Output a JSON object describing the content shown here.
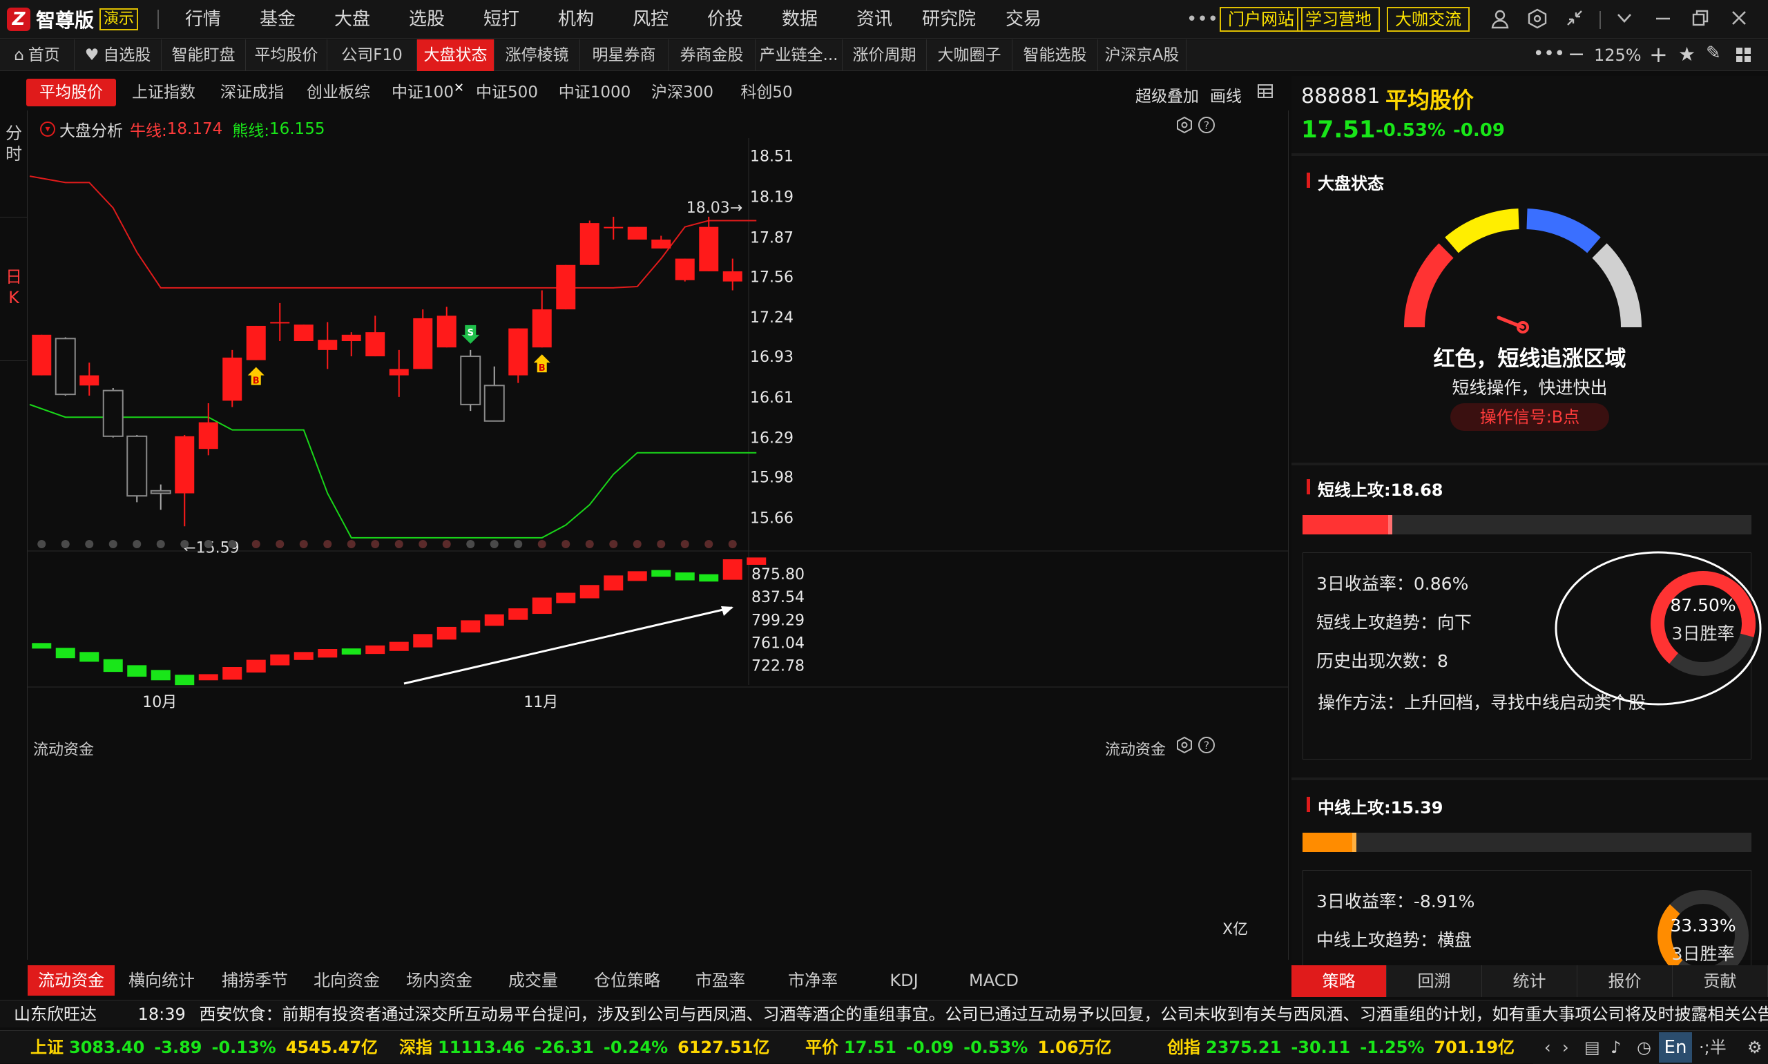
{
  "app": {
    "name": "智尊版",
    "mode_badge": "演示"
  },
  "top_menu": [
    "行情",
    "基金",
    "大盘",
    "选股",
    "短打",
    "机构",
    "风控",
    "价投",
    "数据",
    "资讯",
    "研究院",
    "交易"
  ],
  "top_pills": [
    "门户网站",
    "学习营地",
    "大咖交流"
  ],
  "tabs": [
    {
      "label": "首页",
      "icon": "home-icon"
    },
    {
      "label": "自选股",
      "icon": "heart-icon"
    },
    {
      "label": "智能盯盘"
    },
    {
      "label": "平均股价"
    },
    {
      "label": "公司F10"
    },
    {
      "label": "大盘状态",
      "active": true
    },
    {
      "label": "涨停棱镜"
    },
    {
      "label": "明星券商"
    },
    {
      "label": "券商金股"
    },
    {
      "label": "产业链全..."
    },
    {
      "label": "涨价周期"
    },
    {
      "label": "大咖圈子"
    },
    {
      "label": "智能选股"
    },
    {
      "label": "沪深京A股"
    }
  ],
  "zoom": "125%",
  "sub_tabs": [
    "平均股价",
    "上证指数",
    "深证成指",
    "创业板综",
    "中证100",
    "中证500",
    "中证1000",
    "沪深300",
    "科创50"
  ],
  "chart_tools": [
    "超级叠加",
    "画线"
  ],
  "left_modes": {
    "intraday": "分时",
    "daily": "日K"
  },
  "indicator_header": {
    "name": "大盘分析",
    "bull_label": "牛线:",
    "bull_value": "18.174",
    "bear_label": "熊线:",
    "bear_value": "16.155"
  },
  "annotations": {
    "high": "18.03→",
    "low": "←15.59"
  },
  "lower_panel": {
    "title": "流动资金",
    "right_title": "流动资金",
    "unit": "X亿"
  },
  "x_axis_labels": [
    "10月",
    "11月"
  ],
  "bottom_tabs": [
    "流动资金",
    "横向统计",
    "捕捞季节",
    "北向资金",
    "场内资金",
    "成交量",
    "仓位策略",
    "市盈率",
    "市净率",
    "KDJ",
    "MACD"
  ],
  "stock": {
    "code": "888881",
    "name": "平均股价",
    "price": "17.51",
    "change_pct": "-0.53%",
    "change": "-0.09"
  },
  "market_state": {
    "title": "大盘状态",
    "status": "红色，短线追涨区域",
    "advice": "短线操作，快进快出",
    "signal": "操作信号:B点"
  },
  "short_term": {
    "title": "短线上攻:18.68",
    "return_3d": "3日收益率：0.86%",
    "trend": "短线上攻趋势：向下",
    "occurrences": "历史出现次数：8",
    "method": "操作方法：上升回档，寻找中线启动类个股",
    "win_rate": "87.50%",
    "win_rate_label": "3日胜率",
    "win_fraction": 0.875,
    "bar_fill": 0.2
  },
  "mid_term": {
    "title": "中线上攻:15.39",
    "return_3d": "3日收益率：-8.91%",
    "trend": "中线上攻趋势：横盘",
    "win_rate": "33.33%",
    "win_rate_label": "3日胜率",
    "win_fraction": 0.3333,
    "bar_fill": 0.12
  },
  "right_tabs": [
    "策略",
    "回溯",
    "统计",
    "报价",
    "贡献"
  ],
  "ticker": {
    "stock": "山东欣旺达",
    "time": "18:39",
    "text": "西安饮食：前期有投资者通过深交所互动易平台提问，涉及到公司与西凤酒、习酒等酒企的重组事宜。公司已通过互动易予以回复，公司未收到有关与西凤酒、习酒重组的计划，如有重大事项公司将及时披露相关公告"
  },
  "status_bar": [
    {
      "name": "上证",
      "value": "3083.40",
      "change": "-3.89",
      "pct": "-0.13%",
      "amount": "4545.47亿"
    },
    {
      "name": "深指",
      "value": "11113.46",
      "change": "-26.31",
      "pct": "-0.24%",
      "amount": "6127.51亿"
    },
    {
      "name": "平价",
      "value": "17.51",
      "change": "-0.09",
      "pct": "-0.53%",
      "amount": "1.06万亿"
    },
    {
      "name": "创指",
      "value": "2375.21",
      "change": "-30.11",
      "pct": "-1.25%",
      "amount": "701.19亿"
    }
  ],
  "chart_data": [
    {
      "type": "candlestick",
      "title": "大盘分析",
      "y_ticks": [
        18.51,
        18.19,
        17.87,
        17.56,
        17.24,
        16.93,
        16.61,
        16.29,
        15.98,
        15.66
      ],
      "ylim": [
        15.45,
        18.65
      ],
      "x_labels": [
        "10月",
        "11月"
      ],
      "candles": [
        {
          "o": 16.78,
          "c": 17.1,
          "h": 17.1,
          "l": 16.78
        },
        {
          "o": 17.07,
          "c": 16.63,
          "h": 17.08,
          "l": 16.62
        },
        {
          "o": 16.7,
          "c": 16.78,
          "h": 16.88,
          "l": 16.62
        },
        {
          "o": 16.66,
          "c": 16.3,
          "h": 16.68,
          "l": 16.29
        },
        {
          "o": 16.3,
          "c": 15.83,
          "h": 16.31,
          "l": 15.78
        },
        {
          "o": 15.87,
          "c": 15.85,
          "h": 15.92,
          "l": 15.72
        },
        {
          "o": 15.85,
          "c": 16.3,
          "h": 16.31,
          "l": 15.59
        },
        {
          "o": 16.2,
          "c": 16.41,
          "h": 16.56,
          "l": 16.15
        },
        {
          "o": 16.58,
          "c": 16.92,
          "h": 16.98,
          "l": 16.53
        },
        {
          "o": 16.9,
          "c": 17.17,
          "h": 17.17,
          "l": 16.9
        },
        {
          "o": 17.2,
          "c": 17.2,
          "h": 17.35,
          "l": 17.05
        },
        {
          "o": 17.05,
          "c": 17.18,
          "h": 17.18,
          "l": 17.05
        },
        {
          "o": 16.98,
          "c": 17.06,
          "h": 17.2,
          "l": 16.83
        },
        {
          "o": 17.05,
          "c": 17.1,
          "h": 17.12,
          "l": 16.93
        },
        {
          "o": 16.93,
          "c": 17.12,
          "h": 17.25,
          "l": 16.93
        },
        {
          "o": 16.78,
          "c": 16.83,
          "h": 16.98,
          "l": 16.61
        },
        {
          "o": 16.83,
          "c": 17.23,
          "h": 17.3,
          "l": 16.83
        },
        {
          "o": 17.0,
          "c": 17.25,
          "h": 17.32,
          "l": 17.0
        },
        {
          "o": 16.93,
          "c": 16.55,
          "h": 16.98,
          "l": 16.5
        },
        {
          "o": 16.7,
          "c": 16.42,
          "h": 16.85,
          "l": 16.42
        },
        {
          "o": 16.78,
          "c": 17.15,
          "h": 17.15,
          "l": 16.72
        },
        {
          "o": 17.0,
          "c": 17.3,
          "h": 17.45,
          "l": 17.0
        },
        {
          "o": 17.3,
          "c": 17.65,
          "h": 17.65,
          "l": 17.3
        },
        {
          "o": 17.65,
          "c": 17.98,
          "h": 18.0,
          "l": 17.65
        },
        {
          "o": 17.95,
          "c": 17.95,
          "h": 18.03,
          "l": 17.85
        },
        {
          "o": 17.85,
          "c": 17.95,
          "h": 17.95,
          "l": 17.85
        },
        {
          "o": 17.78,
          "c": 17.85,
          "h": 17.88,
          "l": 17.78
        },
        {
          "o": 17.53,
          "c": 17.7,
          "h": 17.7,
          "l": 17.52
        },
        {
          "o": 17.6,
          "c": 17.95,
          "h": 18.03,
          "l": 17.6
        },
        {
          "o": 17.52,
          "c": 17.6,
          "h": 17.7,
          "l": 17.45
        }
      ],
      "series": [
        {
          "name": "牛线",
          "color": "#e01b1b",
          "values": [
            18.35,
            18.3,
            18.3,
            18.1,
            17.75,
            17.47,
            17.47,
            17.47,
            17.47,
            17.47,
            17.47,
            17.47,
            17.47,
            17.47,
            17.47,
            17.47,
            17.47,
            17.47,
            17.47,
            17.47,
            17.47,
            17.47,
            17.47,
            17.47,
            17.47,
            17.48,
            17.7,
            17.95,
            18.0,
            18.0,
            18.0
          ]
        },
        {
          "name": "熊线",
          "color": "#19d619",
          "values": [
            16.55,
            16.45,
            16.45,
            16.45,
            16.45,
            16.45,
            16.45,
            16.45,
            16.35,
            16.35,
            16.35,
            16.35,
            15.85,
            15.5,
            15.5,
            15.5,
            15.5,
            15.5,
            15.5,
            15.5,
            15.5,
            15.5,
            15.6,
            15.76,
            16.0,
            16.17,
            16.17,
            16.17,
            16.17,
            16.17,
            16.17
          ]
        }
      ],
      "signals": [
        {
          "index": 9,
          "label": "B",
          "kind": "buy"
        },
        {
          "index": 18,
          "label": "S",
          "kind": "sell"
        },
        {
          "index": 21,
          "label": "B",
          "kind": "buy"
        }
      ]
    },
    {
      "type": "bar",
      "title": "流动资金",
      "unit": "X亿",
      "y_ticks": [
        875.8,
        837.54,
        799.29,
        761.04,
        722.78
      ],
      "ylim": [
        690,
        900
      ],
      "values": [
        760,
        752,
        745,
        733,
        723,
        715,
        707,
        708,
        720,
        732,
        741,
        745,
        750,
        751,
        756,
        762,
        775,
        787,
        798,
        808,
        818,
        836,
        844,
        857,
        873,
        880,
        882,
        878,
        875,
        900,
        903
      ],
      "colors": [
        "green",
        "green",
        "green",
        "green",
        "green",
        "green",
        "green",
        "red",
        "red",
        "red",
        "red",
        "red",
        "red",
        "green",
        "red",
        "red",
        "red",
        "red",
        "red",
        "red",
        "red",
        "red",
        "red",
        "red",
        "red",
        "red",
        "green",
        "green",
        "green",
        "red",
        "red"
      ]
    }
  ]
}
